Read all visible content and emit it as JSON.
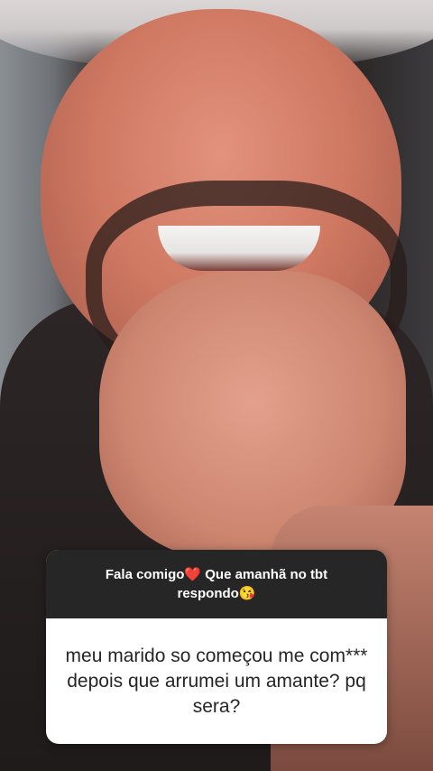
{
  "question_sticker": {
    "prompt": "Fala comigo❤️ Que amanhã no tbt respondo😘",
    "answer": "meu marido so começou me com*** depois que arrumei um amante? pq sera?"
  },
  "colors": {
    "sticker_header_bg": "#262626",
    "sticker_body_bg": "#ffffff",
    "sticker_header_text": "#ffffff",
    "sticker_body_text": "#262626"
  }
}
